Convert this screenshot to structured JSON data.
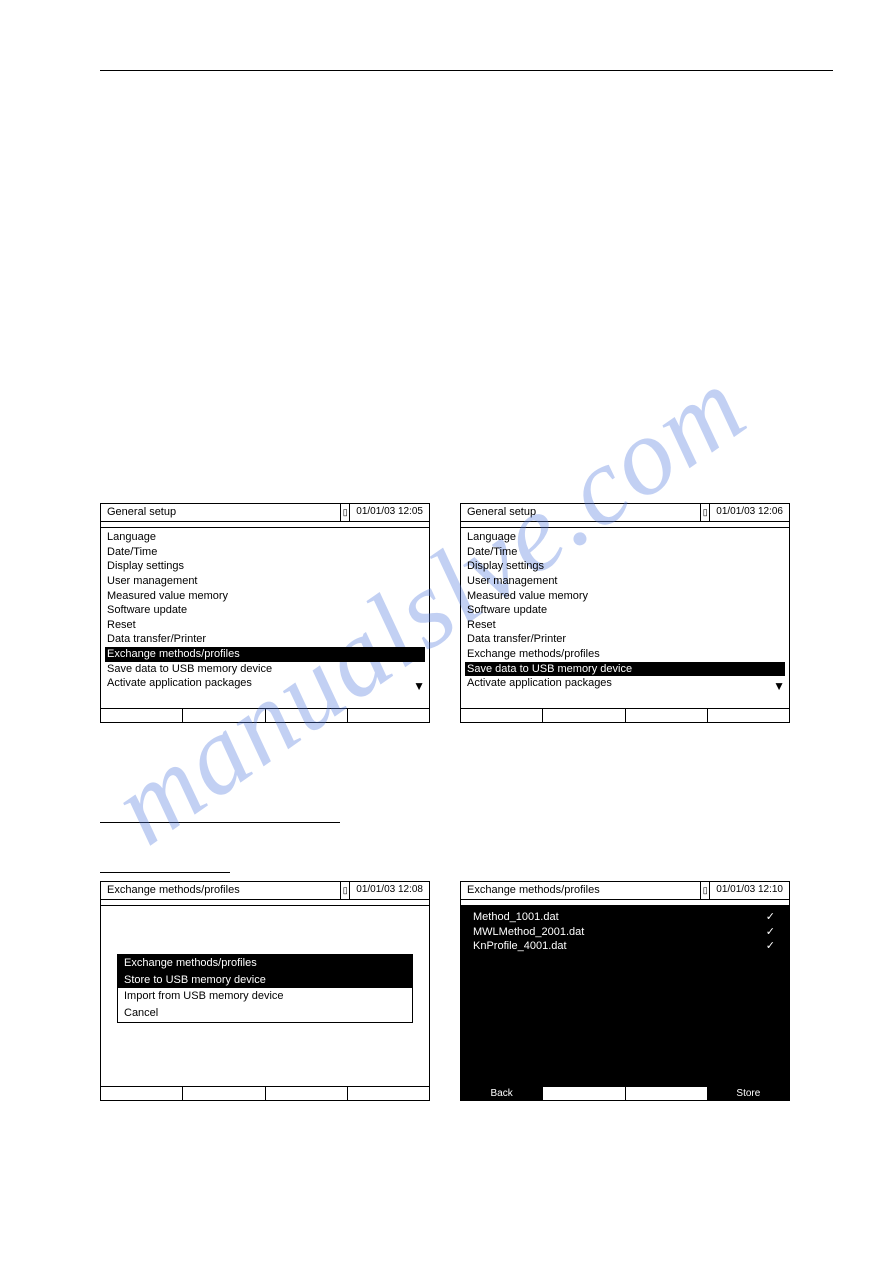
{
  "watermark": "manualslve.com",
  "screens": {
    "a": {
      "title": "General setup",
      "date": "01/01/03 12:05",
      "items": [
        "Language",
        "Date/Time",
        "Display settings",
        "User management",
        "Measured value memory",
        "Software update",
        "Reset",
        "Data transfer/Printer",
        "Exchange methods/profiles",
        "Save data to USB memory device",
        "Activate application packages"
      ],
      "selected_index": 8
    },
    "b": {
      "title": "General setup",
      "date": "01/01/03 12:06",
      "items": [
        "Language",
        "Date/Time",
        "Display settings",
        "User management",
        "Measured value memory",
        "Software update",
        "Reset",
        "Data transfer/Printer",
        "Exchange methods/profiles",
        "Save data to USB memory device",
        "Activate application packages"
      ],
      "selected_index": 9
    },
    "c": {
      "title": "Exchange methods/profiles",
      "date": "01/01/03 12:08",
      "popup_title": "Exchange methods/profiles",
      "popup_items": [
        "Store to USB memory device",
        "Import from USB memory device",
        "Cancel"
      ],
      "popup_selected_index": 0
    },
    "d": {
      "title": "Exchange methods/profiles",
      "date": "01/01/03 12:10",
      "files": [
        {
          "name": "Method_1001.dat",
          "checked": true,
          "selected": true
        },
        {
          "name": "MWLMethod_2001.dat",
          "checked": true,
          "selected": false
        },
        {
          "name": "KnProfile_4001.dat",
          "checked": true,
          "selected": false
        }
      ],
      "footer": [
        "Back",
        "",
        "",
        "Store"
      ]
    }
  }
}
